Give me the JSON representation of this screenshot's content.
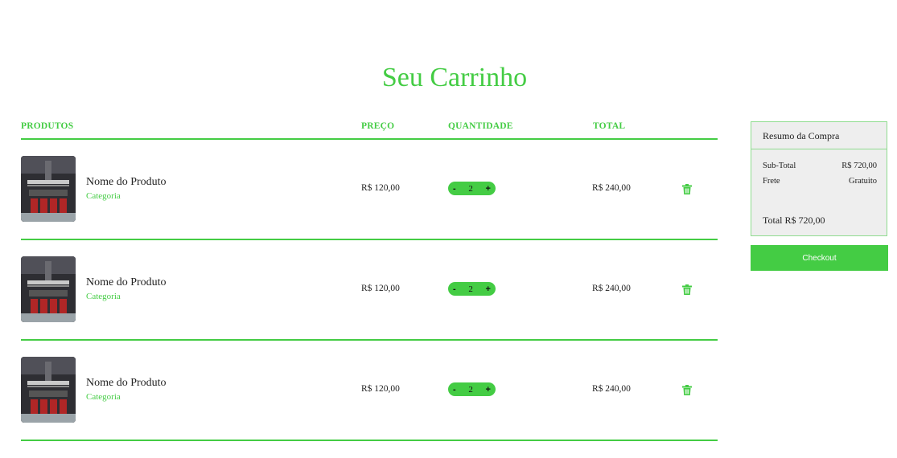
{
  "page": {
    "title": "Seu Carrinho"
  },
  "cart": {
    "headers": {
      "products": "PRODUTOS",
      "price": "PREÇO",
      "quantity": "QUANTIDADE",
      "total": "TOTAL"
    },
    "items": [
      {
        "name": "Nome do Produto",
        "category": "Categoria",
        "price": "R$ 120,00",
        "quantity": "2",
        "total": "R$ 240,00",
        "minus": "-",
        "plus": "+"
      },
      {
        "name": "Nome do Produto",
        "category": "Categoria",
        "price": "R$ 120,00",
        "quantity": "2",
        "total": "R$ 240,00",
        "minus": "-",
        "plus": "+"
      },
      {
        "name": "Nome do Produto",
        "category": "Categoria",
        "price": "R$ 120,00",
        "quantity": "2",
        "total": "R$ 240,00",
        "minus": "-",
        "plus": "+"
      }
    ]
  },
  "summary": {
    "title": "Resumo da Compra",
    "subtotal_label": "Sub-Total",
    "subtotal_value": "R$ 720,00",
    "shipping_label": "Frete",
    "shipping_value": "Gratuito",
    "total": "Total R$ 720,00",
    "checkout_label": "Checkout"
  },
  "icons": {
    "delete": "trash-icon",
    "product_image": "building-facade-photo"
  },
  "colors": {
    "accent": "#44cc44",
    "summary_bg": "#eeeeee"
  }
}
